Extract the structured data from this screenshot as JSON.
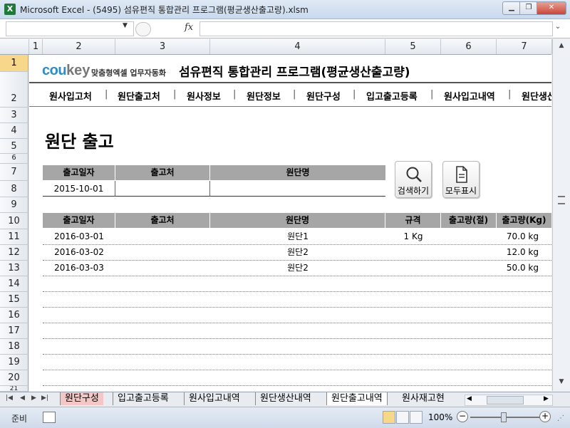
{
  "window": {
    "title": "Microsoft Excel - (5495) 섬유편직 통합관리 프로그램(평균생산출고량).xlsm",
    "app_icon": "X",
    "minimize_icon": "minimize-icon",
    "maximize_icon": "restore-icon",
    "close_icon": "close-icon"
  },
  "formula_bar": {
    "fx_label": "fx",
    "name_box_value": "",
    "formula_value": ""
  },
  "columns": [
    "1",
    "2",
    "3",
    "4",
    "5",
    "6",
    "7"
  ],
  "rows": [
    "1",
    "2",
    "3",
    "4",
    "5",
    "6",
    "7",
    "8",
    "9",
    "10",
    "11",
    "12",
    "13",
    "14",
    "15",
    "16",
    "17",
    "18",
    "19",
    "20",
    "21"
  ],
  "header": {
    "logo_cou": "cou",
    "logo_key": "key",
    "logo_tagline": "맞춤형엑셀 업무자동화",
    "title": "섬유편직 통합관리 프로그램(평균생산출고량)"
  },
  "menu": [
    "원사입고처",
    "원단출고처",
    "원사정보",
    "원단정보",
    "원단구성",
    "입고출고등록",
    "원사입고내역",
    "원단생산"
  ],
  "menu_separator": "|",
  "page_title": "원단 출고",
  "search_form": {
    "headers": [
      "출고일자",
      "출고처",
      "원단명"
    ],
    "values": [
      "2015-10-01",
      "",
      ""
    ]
  },
  "buttons": {
    "search": {
      "label": "검색하기",
      "icon": "magnifier-icon"
    },
    "show_all": {
      "label": "모두표시",
      "icon": "document-icon"
    }
  },
  "table": {
    "headers": [
      "출고일자",
      "출고처",
      "원단명",
      "규격",
      "출고량(절)",
      "출고량(Kg)"
    ],
    "rows": [
      [
        "2016-03-01",
        "",
        "원단1",
        "1 Kg",
        "",
        "70.0 kg"
      ],
      [
        "2016-03-02",
        "",
        "원단2",
        "",
        "",
        "12.0 kg"
      ],
      [
        "2016-03-03",
        "",
        "원단2",
        "",
        "",
        "50.0 kg"
      ]
    ]
  },
  "sheet_tabs": [
    "원단구성",
    "입고출고등록",
    "원사입고내역",
    "원단생산내역",
    "원단출고내역",
    "원사재고현"
  ],
  "active_tab": "원단출고내역",
  "status": {
    "text": "준비",
    "zoom": "100%"
  }
}
